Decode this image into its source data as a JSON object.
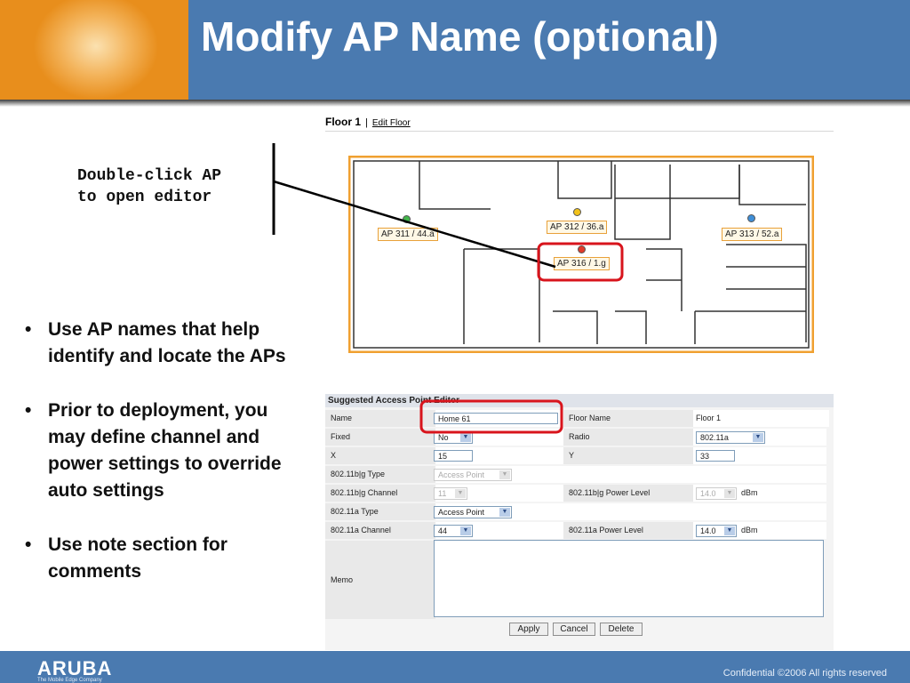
{
  "slide": {
    "title": "Modify AP Name (optional)",
    "callout": [
      "Double-click AP",
      "to open editor"
    ],
    "bullets": [
      "Use AP names that help identify and locate the APs",
      "Prior to deployment, you may define channel and power settings to override auto settings",
      "Use note section for comments"
    ],
    "colors": {
      "header": "#4a7ab0",
      "highlight": "#d8141c",
      "plan_border": "#f0a030"
    }
  },
  "floor": {
    "title": "Floor 1",
    "separator": "|",
    "edit_link": "Edit Floor",
    "aps": [
      {
        "label": "AP 311 / 44.a",
        "icon": "green-ap-icon"
      },
      {
        "label": "AP 312 / 36.a",
        "icon": "yellow-ap-icon"
      },
      {
        "label": "AP 313 / 52.a",
        "icon": "blue-ap-icon"
      },
      {
        "label": "AP 316 / 1.g",
        "icon": "red-ap-icon"
      }
    ]
  },
  "editor": {
    "title": "Suggested Access Point Editor",
    "labels": {
      "name": "Name",
      "fixed": "Fixed",
      "x": "X",
      "bg_type": "802.11b|g Type",
      "bg_channel": "802.11b|g Channel",
      "a_type": "802.11a Type",
      "a_channel": "802.11a Channel",
      "memo": "Memo",
      "floor_name": "Floor Name",
      "radio": "Radio",
      "y": "Y",
      "bg_power": "802.11b|g Power Level",
      "a_power": "802.11a Power Level"
    },
    "values": {
      "name": "Home 61",
      "fixed": "No",
      "x": "15",
      "bg_type": "Access Point",
      "bg_channel": "11",
      "a_type": "Access Point",
      "a_channel": "44",
      "floor_name": "Floor 1",
      "radio": "802.11a",
      "y": "33",
      "bg_power": "14.0",
      "a_power": "14.0",
      "unit": "dBm"
    },
    "buttons": {
      "apply": "Apply",
      "cancel": "Cancel",
      "delete": "Delete"
    }
  },
  "footer": {
    "logo": "ARUBA",
    "tagline": "The Mobile Edge Company",
    "confidential": "Confidential  ©2006 All rights reserved"
  }
}
